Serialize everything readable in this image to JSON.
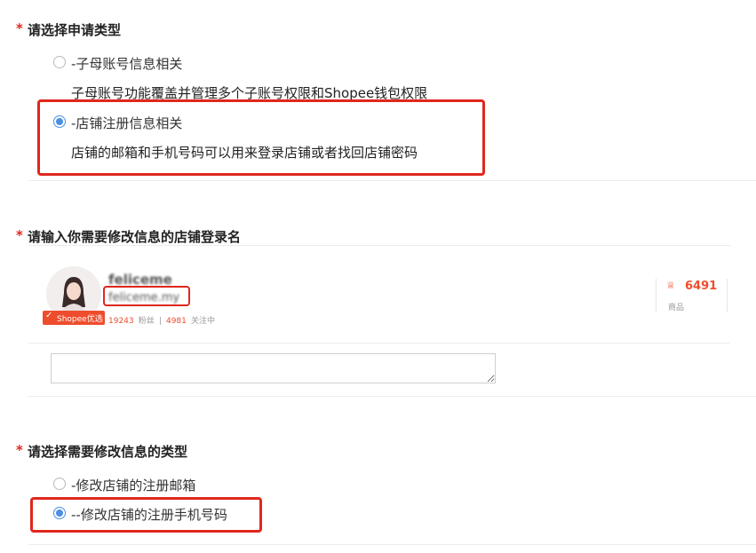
{
  "section1": {
    "title": "请选择申请类型",
    "options": [
      {
        "label": "-子母账号信息相关",
        "desc": "子母账号功能覆盖并管理多个子账号权限和Shopee钱包权限",
        "checked": false
      },
      {
        "label": "-店铺注册信息相关",
        "desc": "店铺的邮箱和手机号码可以用来登录店铺或者找回店铺密码",
        "checked": true
      }
    ]
  },
  "section2": {
    "title": "请输入你需要修改信息的店铺登录名",
    "shop": {
      "name": "feliceme",
      "username": "feliceme.my",
      "badge": "Shopee优选",
      "stats": {
        "followers_count": "19243",
        "followers_label": "粉丝",
        "following_count": "4981",
        "following_label": "关注中"
      },
      "products_count": "6491",
      "products_label": "商品"
    },
    "textarea_value": ""
  },
  "section3": {
    "title": "请选择需要修改信息的类型",
    "options": [
      {
        "label": "-修改店铺的注册邮箱",
        "checked": false
      },
      {
        "label": "--修改店铺的注册手机号码",
        "checked": true
      }
    ]
  },
  "colors": {
    "required_star": "#e0271c",
    "highlight": "#e0271c",
    "radio_checked": "#4a90e2",
    "accent": "#ee4d2d"
  }
}
